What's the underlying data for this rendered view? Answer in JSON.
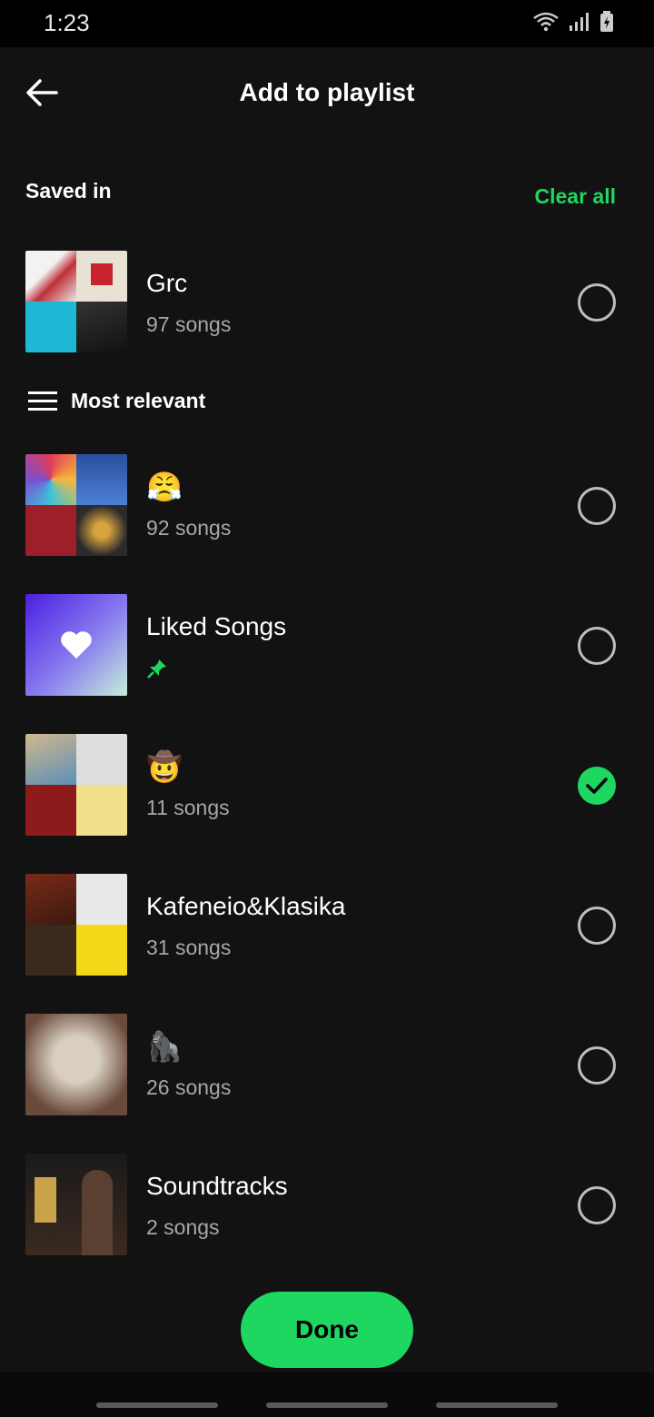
{
  "status_bar": {
    "time": "1:23"
  },
  "header": {
    "title": "Add to playlist"
  },
  "saved_in": {
    "label": "Saved in",
    "clear_label": "Clear all",
    "playlist": {
      "name": "Grc",
      "count": "97 songs",
      "selected": false
    }
  },
  "sort": {
    "label": "Most relevant"
  },
  "playlists": [
    {
      "name": "😤",
      "count": "92 songs",
      "selected": false
    },
    {
      "name": "Liked Songs",
      "pinned": true,
      "selected": false
    },
    {
      "name": "🤠",
      "count": "11 songs",
      "selected": true
    },
    {
      "name": "Kafeneio&Klasika",
      "count": "31 songs",
      "selected": false
    },
    {
      "name": "🦍",
      "count": "26 songs",
      "selected": false
    },
    {
      "name": "Soundtracks",
      "count": "2 songs",
      "selected": false
    }
  ],
  "done_button": {
    "label": "Done"
  },
  "colors": {
    "accent": "#1ed760",
    "background": "#121212"
  }
}
